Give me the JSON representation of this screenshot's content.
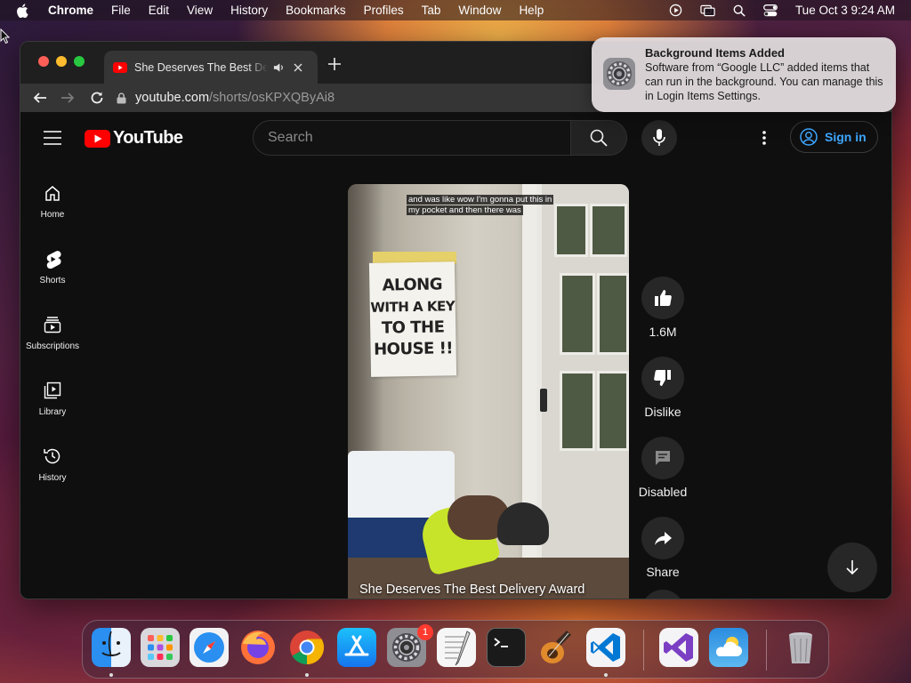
{
  "menubar": {
    "app_name": "Chrome",
    "items": [
      "File",
      "Edit",
      "View",
      "History",
      "Bookmarks",
      "Profiles",
      "Tab",
      "Window",
      "Help"
    ],
    "clock": "Tue Oct 3  9:24 AM",
    "status_icons": [
      "play-circle-icon",
      "screen-mirroring-icon",
      "search-icon",
      "control-center-icon"
    ]
  },
  "browser": {
    "tab": {
      "title": "She Deserves The Best Delivery Award - YouTube",
      "favicon": "youtube-icon",
      "audio": "speaker-icon"
    },
    "address": {
      "host": "youtube.com",
      "path": "/shorts/osKPXQByAi8"
    }
  },
  "youtube": {
    "logo_text": "YouTube",
    "search": {
      "placeholder": "Search"
    },
    "signin_label": "Sign in",
    "guide": [
      {
        "label": "Home",
        "icon": "home-icon"
      },
      {
        "label": "Shorts",
        "icon": "shorts-icon"
      },
      {
        "label": "Subscriptions",
        "icon": "subscriptions-icon"
      },
      {
        "label": "Library",
        "icon": "library-icon"
      },
      {
        "label": "History",
        "icon": "history-icon"
      }
    ],
    "short": {
      "caption_line1": "and was like wow I'm gonna put this in",
      "caption_line2": "my pocket and then there was",
      "sign_text_1": "ALONG",
      "sign_text_2": "WITH A KEY",
      "sign_text_3": "TO THE",
      "sign_text_4": "HOUSE !!",
      "title": "She Deserves The Best Delivery Award"
    },
    "actions": {
      "like_count": "1.6M",
      "dislike_label": "Dislike",
      "comments_label": "Disabled",
      "share_label": "Share"
    }
  },
  "notification": {
    "title": "Background Items Added",
    "body": "Software from “Google LLC” added items that can run in the background. You can manage this in Login Items Settings."
  },
  "dock": {
    "apps": [
      "Finder",
      "Launchpad",
      "Safari",
      "Firefox",
      "Google Chrome",
      "App Store",
      "System Settings",
      "TextEdit",
      "Terminal",
      "GarageBand",
      "Visual Studio Code",
      "Visual Studio",
      "Weather",
      "Trash"
    ],
    "settings_badge": "1"
  },
  "colors": {
    "youtube_red": "#ff0000",
    "signin_blue": "#3ea6ff",
    "page_bg": "#0f0f0f"
  }
}
